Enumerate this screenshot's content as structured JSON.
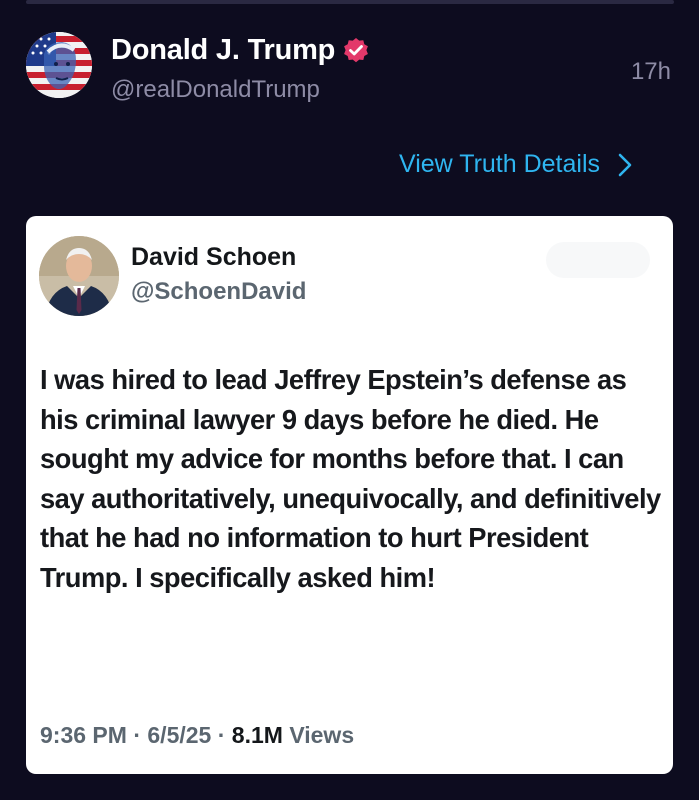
{
  "post": {
    "author_name": "Donald J. Trump",
    "handle": "@realDonaldTrump",
    "time": "17h",
    "view_details": "View Truth Details"
  },
  "quoted": {
    "author_name": "David Schoen",
    "handle": "@SchoenDavid",
    "text": "I was hired to lead Jeffrey Epstein’s defense as his criminal lawyer 9 days before he died.  He sought my advice for months before that.  I can say authoritatively, unequivocally, and definitively that he had no information to hurt President Trump.  I specifically asked him!",
    "time": "9:36 PM",
    "date": "6/5/25",
    "views_count": "8.1M",
    "views_label": "Views",
    "separator": " · "
  },
  "colors": {
    "background": "#0d0c1f",
    "accent_link": "#2fb5f0",
    "verified_badge": "#e3386a",
    "card": "#ffffff"
  },
  "icons": [
    "verified-badge-icon",
    "chevron-right-icon"
  ]
}
